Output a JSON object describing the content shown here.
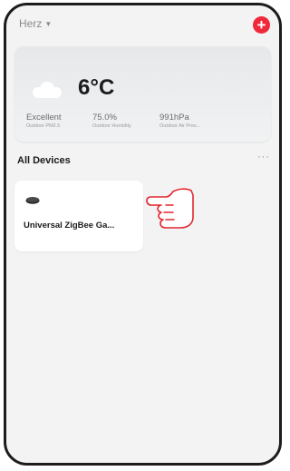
{
  "header": {
    "home_name": "Herz",
    "add_label": "+"
  },
  "weather": {
    "temperature": "6°C",
    "stats": [
      {
        "value": "Excellent",
        "label": "Outdoor PM2.5"
      },
      {
        "value": "75.0%",
        "label": "Outdoor Humidity"
      },
      {
        "value": "991hPa",
        "label": "Outdoor Air Pres..."
      }
    ]
  },
  "devices": {
    "title": "All Devices",
    "more_label": "···",
    "items": [
      {
        "name": "Universal ZigBee Ga..."
      }
    ]
  },
  "colors": {
    "accent": "#f0283b",
    "hand_outline": "#e3262f"
  }
}
